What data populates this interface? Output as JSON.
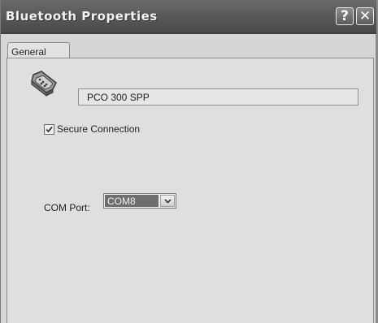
{
  "window": {
    "title": "Bluetooth Properties",
    "help_label": "?",
    "close_label": "✕"
  },
  "tabs": [
    {
      "label": "General",
      "active": true
    }
  ],
  "general": {
    "device_icon": "serial-port-icon",
    "device_name": "PCO 300 SPP",
    "secure_connection": {
      "label": "Secure Connection",
      "checked": true
    },
    "com_port": {
      "label": "COM Port:",
      "value": "COM8"
    }
  }
}
